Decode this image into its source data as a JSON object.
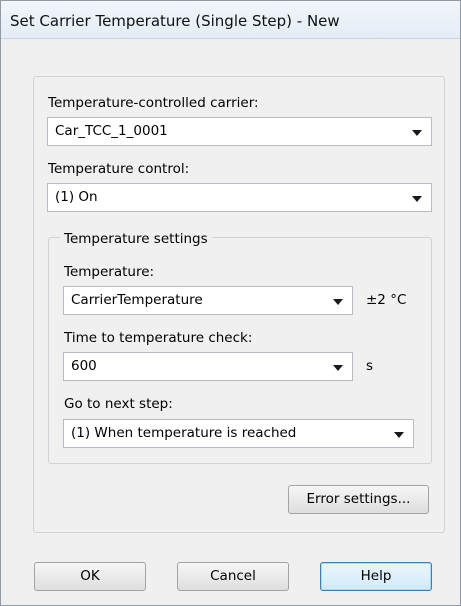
{
  "window": {
    "title": "Set Carrier Temperature (Single Step) - New"
  },
  "carrier": {
    "label": "Temperature-controlled carrier:",
    "value": "Car_TCC_1_0001"
  },
  "control": {
    "label": "Temperature control:",
    "value": "(1) On"
  },
  "settings": {
    "group_label": "Temperature settings",
    "temperature": {
      "label": "Temperature:",
      "value": "CarrierTemperature",
      "unit": "±2 °C"
    },
    "time_check": {
      "label": "Time to temperature check:",
      "value": "600",
      "unit": "s"
    },
    "next_step": {
      "label": "Go to next step:",
      "value": "(1) When temperature is reached"
    }
  },
  "buttons": {
    "error_settings": "Error settings...",
    "ok": "OK",
    "cancel": "Cancel",
    "help": "Help"
  },
  "icons": {
    "dropdown": "chevron-down-icon"
  }
}
